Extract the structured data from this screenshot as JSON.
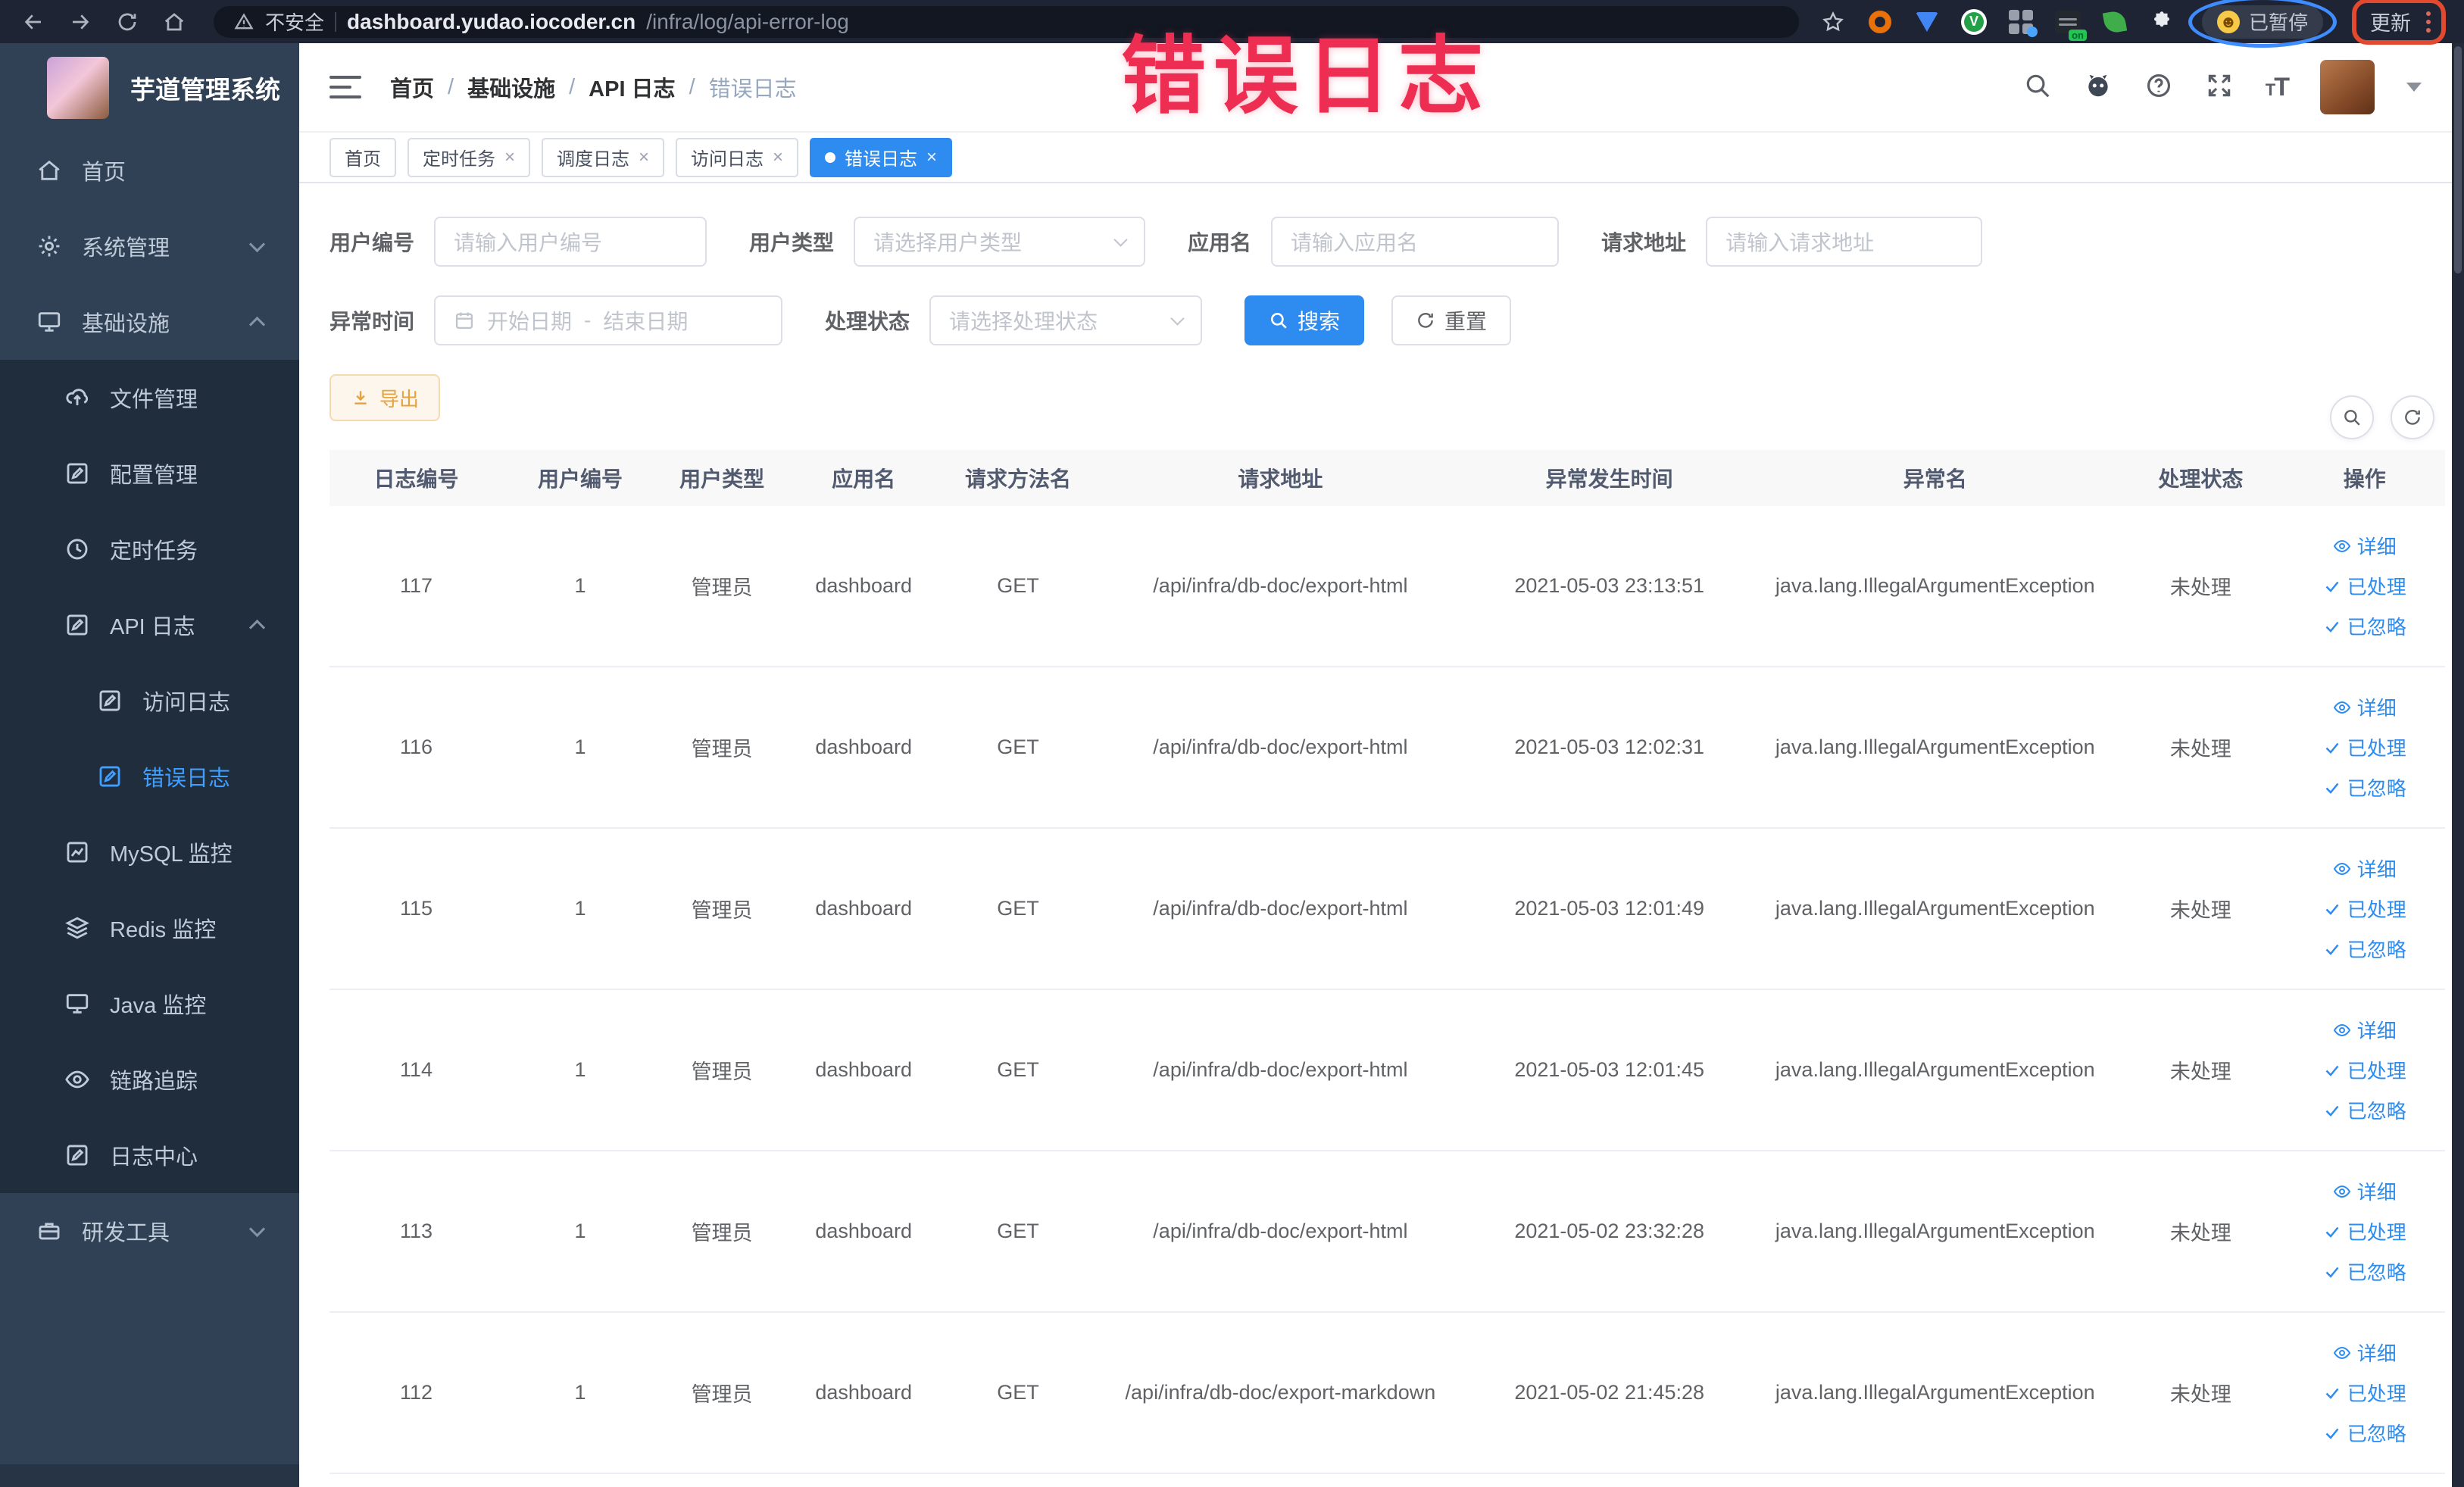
{
  "watermark": "错误日志",
  "browser": {
    "security_label": "不安全",
    "url_host": "dashboard.yudao.iocoder.cn",
    "url_path": "/infra/log/api-error-log",
    "paused_badge": "已暂停",
    "update_label": "更新"
  },
  "sidebar": {
    "title": "芋道管理系统",
    "items": [
      {
        "label": "首页"
      },
      {
        "label": "系统管理"
      },
      {
        "label": "基础设施"
      },
      {
        "label": "文件管理"
      },
      {
        "label": "配置管理"
      },
      {
        "label": "定时任务"
      },
      {
        "label": "API 日志"
      },
      {
        "label": "访问日志"
      },
      {
        "label": "错误日志"
      },
      {
        "label": "MySQL 监控"
      },
      {
        "label": "Redis 监控"
      },
      {
        "label": "Java 监控"
      },
      {
        "label": "链路追踪"
      },
      {
        "label": "日志中心"
      },
      {
        "label": "研发工具"
      }
    ]
  },
  "breadcrumb": [
    "首页",
    "基础设施",
    "API 日志",
    "错误日志"
  ],
  "tabs": [
    {
      "label": "首页"
    },
    {
      "label": "定时任务"
    },
    {
      "label": "调度日志"
    },
    {
      "label": "访问日志"
    },
    {
      "label": "错误日志"
    }
  ],
  "filters": {
    "user_id_label": "用户编号",
    "user_id_placeholder": "请输入用户编号",
    "user_type_label": "用户类型",
    "user_type_placeholder": "请选择用户类型",
    "app_name_label": "应用名",
    "app_name_placeholder": "请输入应用名",
    "request_url_label": "请求地址",
    "request_url_placeholder": "请输入请求地址",
    "time_label": "异常时间",
    "time_start_placeholder": "开始日期",
    "time_separator": "-",
    "time_end_placeholder": "结束日期",
    "status_label": "处理状态",
    "status_placeholder": "请选择处理状态",
    "search_label": "搜索",
    "reset_label": "重置"
  },
  "toolbar": {
    "export_label": "导出"
  },
  "table": {
    "columns": [
      "日志编号",
      "用户编号",
      "用户类型",
      "应用名",
      "请求方法名",
      "请求地址",
      "异常发生时间",
      "异常名",
      "处理状态",
      "操作"
    ],
    "action_detail": "详细",
    "action_processed": "已处理",
    "action_ignored": "已忽略",
    "rows": [
      {
        "id": "117",
        "user_id": "1",
        "user_type": "管理员",
        "app_name": "dashboard",
        "method": "GET",
        "url": "/api/infra/db-doc/export-html",
        "time": "2021-05-03 23:13:51",
        "exception": "java.lang.IllegalArgumentException",
        "status": "未处理"
      },
      {
        "id": "116",
        "user_id": "1",
        "user_type": "管理员",
        "app_name": "dashboard",
        "method": "GET",
        "url": "/api/infra/db-doc/export-html",
        "time": "2021-05-03 12:02:31",
        "exception": "java.lang.IllegalArgumentException",
        "status": "未处理"
      },
      {
        "id": "115",
        "user_id": "1",
        "user_type": "管理员",
        "app_name": "dashboard",
        "method": "GET",
        "url": "/api/infra/db-doc/export-html",
        "time": "2021-05-03 12:01:49",
        "exception": "java.lang.IllegalArgumentException",
        "status": "未处理"
      },
      {
        "id": "114",
        "user_id": "1",
        "user_type": "管理员",
        "app_name": "dashboard",
        "method": "GET",
        "url": "/api/infra/db-doc/export-html",
        "time": "2021-05-03 12:01:45",
        "exception": "java.lang.IllegalArgumentException",
        "status": "未处理"
      },
      {
        "id": "113",
        "user_id": "1",
        "user_type": "管理员",
        "app_name": "dashboard",
        "method": "GET",
        "url": "/api/infra/db-doc/export-html",
        "time": "2021-05-02 23:32:28",
        "exception": "java.lang.IllegalArgumentException",
        "status": "未处理"
      },
      {
        "id": "112",
        "user_id": "1",
        "user_type": "管理员",
        "app_name": "dashboard",
        "method": "GET",
        "url": "/api/infra/db-doc/export-markdown",
        "time": "2021-05-02 21:45:28",
        "exception": "java.lang.IllegalArgumentException",
        "status": "未处理"
      }
    ]
  },
  "colors": {
    "primary": "#2d8cf0",
    "sidebar_bg": "#304156",
    "submenu_bg": "#1f2d3d",
    "active_link": "#409eff",
    "warning": "#e6a23c",
    "watermark_red": "#ee2d52",
    "tab_active": "#2e8bf0"
  }
}
